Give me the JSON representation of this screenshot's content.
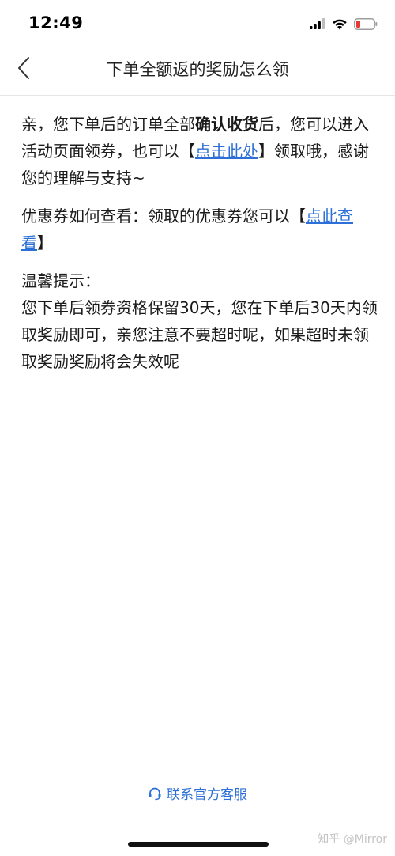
{
  "status_bar": {
    "time": "12:49",
    "icons": [
      "signal-icon",
      "wifi-icon",
      "battery-icon"
    ],
    "battery_color": "#e53935"
  },
  "nav": {
    "back_icon": "chevron-left-icon",
    "title": "下单全额返的奖励怎么领"
  },
  "content": {
    "p1_before": "亲，您下单后的订单全部",
    "p1_bold": "确认收货",
    "p1_mid": "后，您可以进入活动页面领券，也可以【",
    "p1_link": "点击此处",
    "p1_after": "】领取哦，感谢您的理解与支持~",
    "p2_before": "优惠券如何查看：领取的优惠券您可以【",
    "p2_link": "点此查看",
    "p2_after": "】",
    "tip_title": "温馨提示：",
    "tip_body": "您下单后领券资格保留30天，您在下单后30天内领取奖励即可，亲您注意不要超时呢，如果超时未领取奖励奖励将会失效呢"
  },
  "footer": {
    "contact_icon": "headset-icon",
    "contact_label": "联系官方客服",
    "watermark": "知乎 @Mirror"
  },
  "colors": {
    "link": "#2c6fd6",
    "text": "#1a1a1a",
    "divider": "#e6e6e6"
  }
}
